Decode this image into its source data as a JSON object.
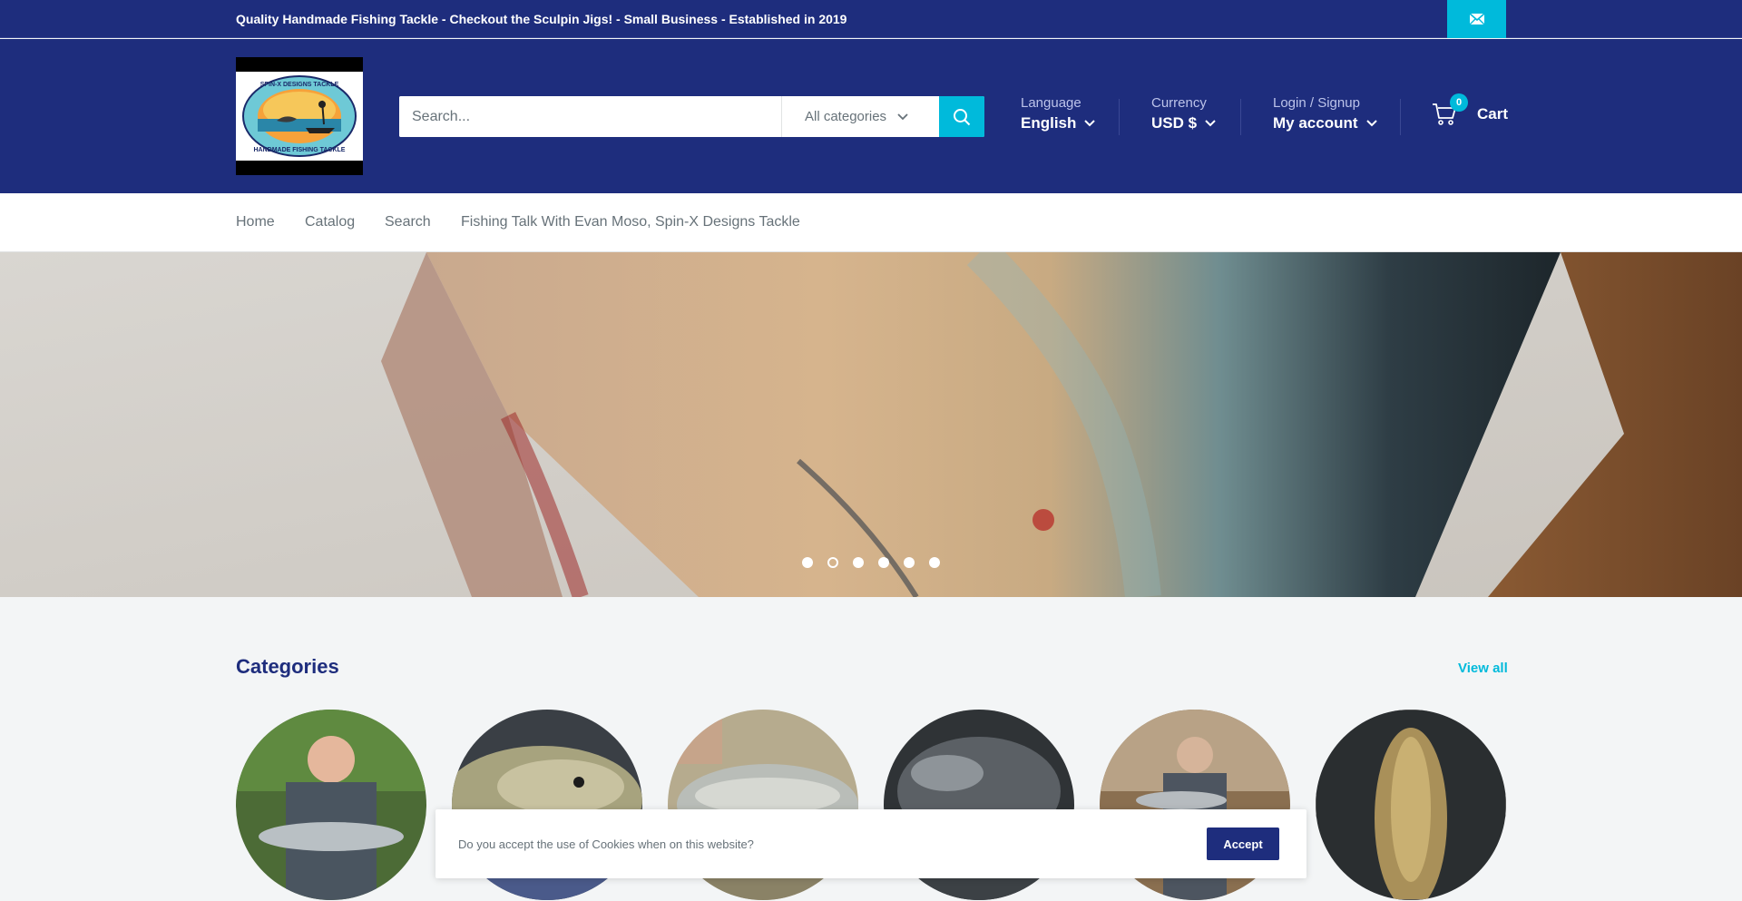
{
  "announcement": {
    "text": "Quality Handmade Fishing Tackle - Checkout the Sculpin Jigs! - Small Business - Established in 2019",
    "icon": "mail-icon"
  },
  "header": {
    "logo_text_top": "SPIN-X DESIGNS TACKLE",
    "logo_text_bottom": "HANDMADE FISHING TACKLE",
    "search_placeholder": "Search...",
    "search_category": "All categories",
    "language_label": "Language",
    "language_value": "English",
    "currency_label": "Currency",
    "currency_value": "USD $",
    "account_label": "Login / Signup",
    "account_value": "My account",
    "cart_count": "0",
    "cart_label": "Cart"
  },
  "nav": {
    "items": [
      "Home",
      "Catalog",
      "Search",
      "Fishing Talk With Evan Moso, Spin-X Designs Tackle"
    ]
  },
  "slideshow": {
    "slide_count": 6,
    "active_index": 1
  },
  "categories": {
    "title": "Categories",
    "view_all": "View all",
    "count": 6
  },
  "cookie": {
    "text": "Do you accept the use of Cookies when on this website?",
    "accept": "Accept"
  },
  "colors": {
    "brand": "#1e2d7d",
    "accent": "#00badb",
    "background": "#f3f5f6"
  }
}
